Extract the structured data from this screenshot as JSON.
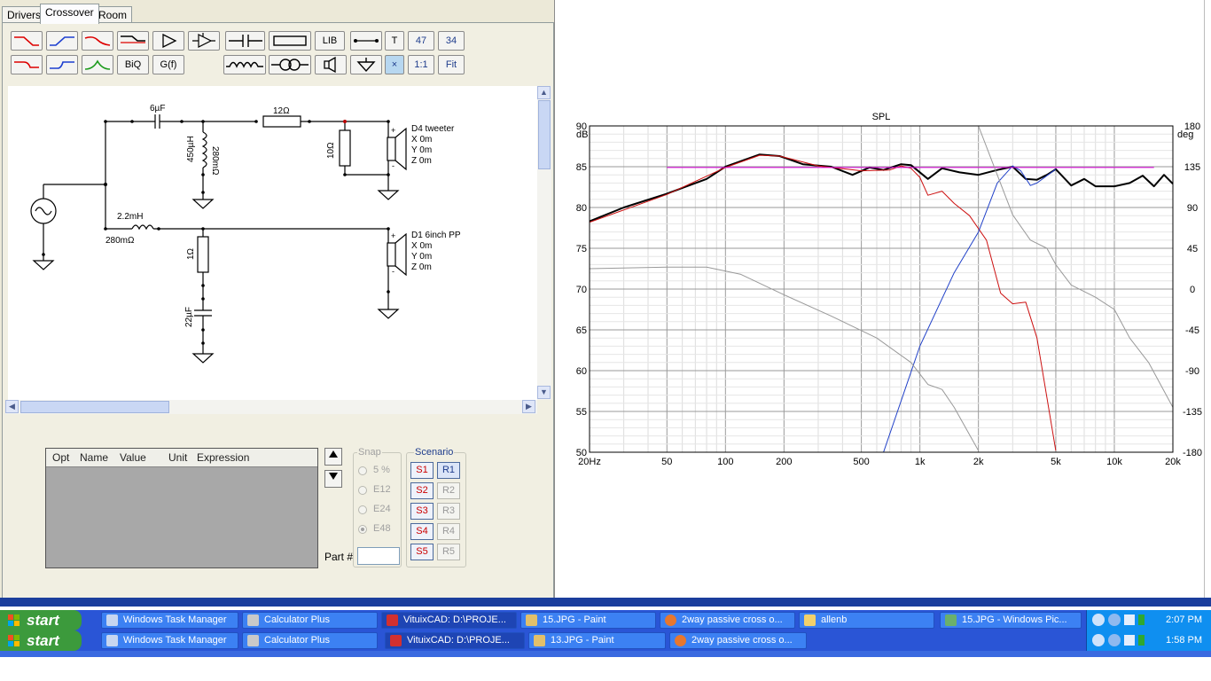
{
  "tabs": [
    "Drivers",
    "Crossover",
    "Room"
  ],
  "toolbar": {
    "row1": [
      "",
      "",
      "",
      "",
      "",
      "",
      "",
      "",
      "LIB",
      "",
      "T",
      "47",
      "34"
    ],
    "row2": [
      "",
      "",
      "",
      "BiQ",
      "G(f)",
      "",
      "",
      "",
      "",
      "×",
      "1:1",
      "Fit"
    ]
  },
  "schematic": {
    "c1": "6µF",
    "r1": "12Ω",
    "l1": "450µH",
    "l1r": "280mΩ",
    "r2": "10Ω",
    "tweeter": [
      "D4 tweeter",
      "X 0m",
      "Y 0m",
      "Z 0m"
    ],
    "l2": "2.2mH",
    "l2r": "280mΩ",
    "r3": "1Ω",
    "c2": "22µF",
    "woofer": [
      "D1 6inch PP",
      "X 0m",
      "Y 0m",
      "Z 0m"
    ]
  },
  "params": {
    "headers": [
      "Opt",
      "Name",
      "Value",
      "Unit",
      "Expression"
    ],
    "snap_title": "Snap",
    "snap_options": [
      "5 %",
      "E12",
      "E24",
      "E48"
    ],
    "scenario_title": "Scenario",
    "scen_s": [
      "S1",
      "S2",
      "S3",
      "S4",
      "S5"
    ],
    "scen_r": [
      "R1",
      "R2",
      "R3",
      "R4",
      "R5"
    ],
    "part_label": "Part #"
  },
  "chart_data": {
    "type": "line",
    "title": "SPL",
    "y_left_unit": [
      "dB"
    ],
    "y_right_unit": [
      "deg"
    ],
    "ylim": [
      50,
      90
    ],
    "y2lim": [
      -180,
      180
    ],
    "xlim": [
      20,
      20000
    ],
    "xscale": "log",
    "x_ticks": [
      {
        "v": 20,
        "t": "20Hz"
      },
      {
        "v": 50,
        "t": "50"
      },
      {
        "v": 100,
        "t": "100"
      },
      {
        "v": 200,
        "t": "200"
      },
      {
        "v": 500,
        "t": "500"
      },
      {
        "v": 1000,
        "t": "1k"
      },
      {
        "v": 2000,
        "t": "2k"
      },
      {
        "v": 5000,
        "t": "5k"
      },
      {
        "v": 10000,
        "t": "10k"
      },
      {
        "v": 20000,
        "t": "20k"
      }
    ],
    "y_ticks": [
      90,
      85,
      80,
      75,
      70,
      65,
      60,
      55,
      50
    ],
    "y2_ticks": [
      180,
      135,
      90,
      45,
      0,
      -45,
      -90,
      -135,
      -180
    ],
    "grid": true,
    "series": [
      {
        "color": "#000000",
        "width": 2,
        "x": [
          20,
          30,
          50,
          80,
          100,
          150,
          190,
          250,
          350,
          450,
          550,
          650,
          800,
          900,
          1100,
          1300,
          1600,
          2000,
          2500,
          3000,
          3500,
          4000,
          4500,
          5000,
          6000,
          7000,
          8000,
          10000,
          12000,
          14000,
          16000,
          18000,
          20000
        ],
        "y": [
          78.3,
          80,
          81.7,
          83.5,
          85,
          86.5,
          86.3,
          85.3,
          85,
          84,
          84.9,
          84.6,
          85.3,
          85.2,
          83.5,
          84.8,
          84.3,
          84,
          84.6,
          85,
          83.5,
          83.4,
          84,
          84.7,
          82.7,
          83.5,
          82.6,
          82.6,
          83,
          83.9,
          82.6,
          84,
          82.9
        ]
      },
      {
        "color": "#cc1010",
        "width": 1,
        "x": [
          20,
          50,
          100,
          150,
          190,
          300,
          500,
          700,
          800,
          900,
          1000,
          1100,
          1300,
          1500,
          1800,
          2200,
          2600,
          3000,
          3500,
          4000,
          5000
        ],
        "y": [
          78.2,
          81.6,
          84.9,
          86.4,
          86.3,
          85.1,
          84.5,
          84.6,
          85.1,
          84.8,
          83.7,
          81.5,
          82,
          80.5,
          79,
          76,
          69.5,
          68.2,
          68.4,
          64,
          50.2
        ]
      },
      {
        "color": "#2040c8",
        "width": 1,
        "x": [
          650,
          1000,
          1500,
          2000,
          2500,
          3000,
          3300,
          3700,
          4000,
          5000
        ],
        "y": [
          50,
          63,
          72,
          77,
          83,
          85.1,
          84.5,
          82.7,
          83,
          84.7
        ]
      },
      {
        "color": "#e000e0",
        "width": 1,
        "x": [
          50,
          16000
        ],
        "y": [
          84.9,
          84.9
        ]
      },
      {
        "color": "#999999",
        "width": 1,
        "x": [
          20,
          50,
          80,
          120,
          200,
          350,
          600,
          900,
          1100,
          1300,
          1500,
          2000
        ],
        "y": [
          72.5,
          72.7,
          72.7,
          71.8,
          69.3,
          66.7,
          64,
          61,
          58.3,
          57.7,
          55.5,
          50.2
        ]
      },
      {
        "color": "#999999",
        "width": 1,
        "x": [
          2000,
          2500,
          3000,
          3700,
          4500,
          5000,
          6000,
          8000,
          10000,
          12000,
          15000,
          20000
        ],
        "y": [
          90,
          84,
          79.1,
          76,
          75,
          73,
          70.5,
          69,
          67.5,
          64,
          61,
          55.5
        ]
      }
    ]
  },
  "taskbar": {
    "start": "start",
    "row1": [
      "Windows Task Manager",
      "Calculator Plus",
      "VituixCAD: D:\\PROJE...",
      "15.JPG - Paint",
      "2way passive cross o...",
      "allenb",
      "15.JPG - Windows Pic..."
    ],
    "row1_time": "2:07 PM",
    "row2": [
      "Windows Task Manager",
      "Calculator Plus",
      "VituixCAD: D:\\PROJE...",
      "13.JPG - Paint",
      "2way passive cross o..."
    ],
    "row2_time": "1:58 PM"
  }
}
